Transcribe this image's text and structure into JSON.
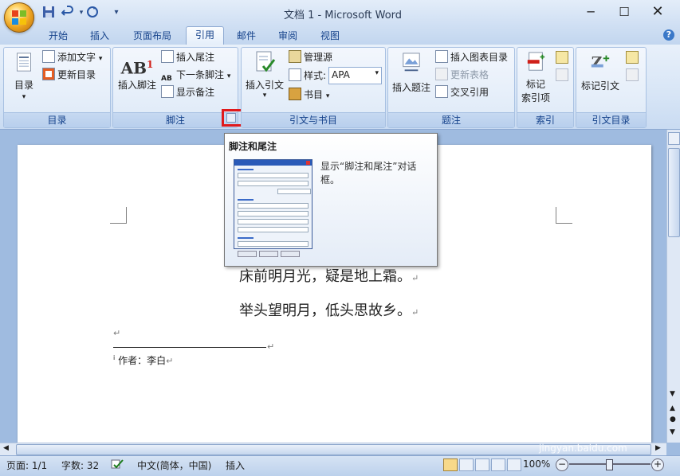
{
  "window": {
    "title": "文档 1 - Microsoft Word"
  },
  "qat": {
    "save": "save-icon",
    "undo": "undo-icon",
    "redo": "redo-icon",
    "customize": "▾"
  },
  "tabs": [
    {
      "label": "开始"
    },
    {
      "label": "插入"
    },
    {
      "label": "页面布局"
    },
    {
      "label": "引用"
    },
    {
      "label": "邮件"
    },
    {
      "label": "审阅"
    },
    {
      "label": "视图"
    }
  ],
  "ribbon": {
    "toc": {
      "label": "目录",
      "big": "目录",
      "add_text": "添加文字",
      "update": "更新目录"
    },
    "footnotes": {
      "label": "脚注",
      "insert_footnote": "插入脚注",
      "insert_endnote": "插入尾注",
      "next_footnote": "下一条脚注",
      "show_notes": "显示备注"
    },
    "citations": {
      "label": "引文与书目",
      "insert_citation": "插入引文",
      "manage_sources": "管理源",
      "style_label": "样式:",
      "style_value": "APA",
      "bibliography": "书目"
    },
    "captions": {
      "label": "题注",
      "insert_caption": "插入题注",
      "insert_table_figures": "插入图表目录",
      "update_table": "更新表格",
      "cross_ref": "交叉引用"
    },
    "index": {
      "label": "索引",
      "mark_entry": "标记\n索引项",
      "mark_entry_l1": "标记",
      "mark_entry_l2": "索引项"
    },
    "toa": {
      "label": "引文目录",
      "mark_citation": "标记引文"
    }
  },
  "tooltip": {
    "title": "脚注和尾注",
    "desc": "显示“脚注和尾注”对话框。"
  },
  "document": {
    "line1": "床前明月光，疑是地上霜。",
    "line2": "举头望明月，低头思故乡。",
    "para_mark": "↵",
    "footnote_ref": "i",
    "footnote_text": "作者：李白"
  },
  "status": {
    "page": "页面: 1/1",
    "words": "字数: 32",
    "lang": "中文(简体，中国)",
    "mode": "插入",
    "zoom": "100%"
  },
  "watermark": {
    "text": "Bai 经验",
    "sub": "jingyan.baidu.com"
  }
}
